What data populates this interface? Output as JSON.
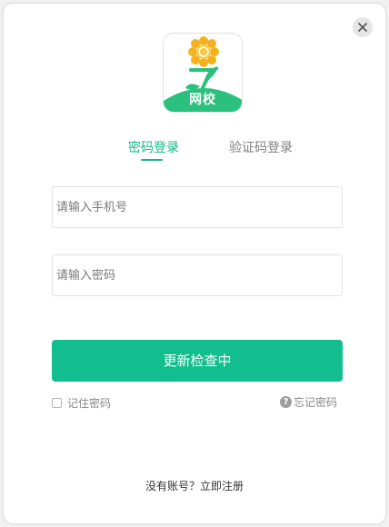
{
  "window": {
    "close_icon": "close-icon"
  },
  "logo": {
    "text": "网校",
    "colors": {
      "green": "#2cc07e",
      "sunflower": "#f5b21c"
    }
  },
  "tabs": [
    {
      "label": "密码登录",
      "active": true
    },
    {
      "label": "验证码登录",
      "active": false
    }
  ],
  "form": {
    "phone_placeholder": "请输入手机号",
    "password_placeholder": "请输入密码",
    "submit_label": "更新检查中",
    "remember_label": "记住密码",
    "remember_checked": false,
    "forgot_label": "忘记密码"
  },
  "footer": {
    "register_text": "没有账号？立即注册"
  },
  "colors": {
    "accent": "#12bd8e",
    "muted": "#8a8a8a"
  }
}
